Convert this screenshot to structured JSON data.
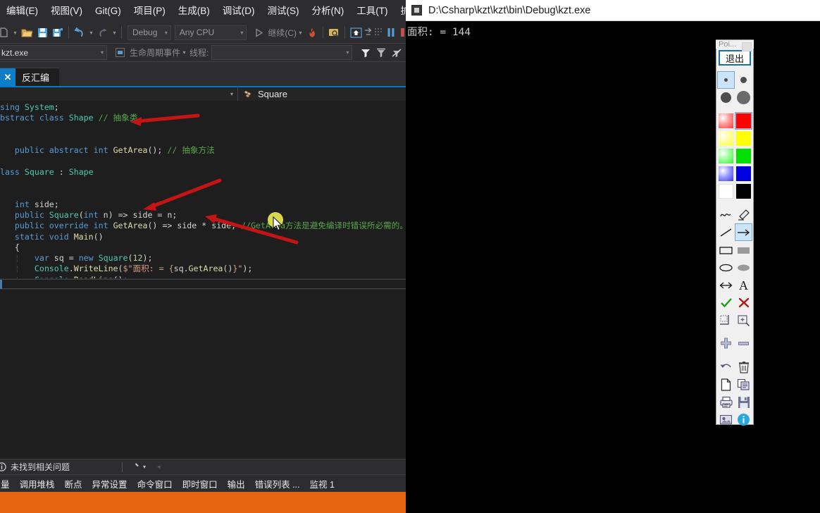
{
  "ide": {
    "menubar": [
      "编辑(E)",
      "视图(V)",
      "Git(G)",
      "项目(P)",
      "生成(B)",
      "调试(D)",
      "测试(S)",
      "分析(N)",
      "工具(T)",
      "扩展(X)"
    ],
    "toolbar": {
      "config_value": "Debug",
      "platform_value": "Any CPU",
      "continue_label": "继续(C)"
    },
    "debugbar": {
      "process_value": "kzt.exe",
      "lifecycle_label": "生命周期事件",
      "thread_label": "线程:",
      "thread_value": ""
    },
    "tab": {
      "close_glyph": "✕",
      "label": "反汇编"
    },
    "navbar": {
      "left_value": "",
      "right_label": "Square"
    },
    "code": {
      "lines": [
        "using System;",
        "abstract class Shape // 抽象类",
        "{",
        "    public abstract int GetArea(); // 抽象方法",
        "}",
        "class Square : Shape",
        "{",
        "    int side;",
        "    public Square(int n) => side = n;",
        "    public override int GetArea() => side * side; //GetArea方法是避免编译时错误所必需的。",
        "    static void Main()",
        "    {",
        "        var sq = new Square(12);",
        "        Console.WriteLine($\"面积: = {sq.GetArea()}\");",
        "        Console.ReadLine();",
        "    }",
        "}"
      ]
    },
    "statusbar": {
      "issues_text": "未找到相关问题"
    },
    "dock_tabs": [
      "量",
      "调用堆栈",
      "断点",
      "异常设置",
      "命令窗口",
      "即时窗口",
      "输出",
      "错误列表 ...",
      "监视 1"
    ]
  },
  "console": {
    "title": "D:\\Csharp\\kzt\\kzt\\bin\\Debug\\kzt.exe",
    "output": "面积: = 144"
  },
  "paint_toolbar": {
    "title": "Poi...",
    "exit_label": "退出",
    "pen_sizes": [
      "pen-size-1",
      "pen-size-2",
      "pen-size-3",
      "pen-size-4"
    ],
    "pen_size_selected": 0,
    "colors": [
      {
        "name": "color-red-light",
        "hex": "#ff6f6f"
      },
      {
        "name": "color-red",
        "hex": "#ff0000"
      },
      {
        "name": "color-yellow-light",
        "hex": "#ffff7f"
      },
      {
        "name": "color-yellow",
        "hex": "#ffff00"
      },
      {
        "name": "color-green-light",
        "hex": "#7fff7f"
      },
      {
        "name": "color-green",
        "hex": "#00e000"
      },
      {
        "name": "color-blue-light",
        "hex": "#7f7fff"
      },
      {
        "name": "color-blue",
        "hex": "#0000e0"
      },
      {
        "name": "color-white",
        "hex": "#ffffff"
      },
      {
        "name": "color-black",
        "hex": "#000000"
      }
    ],
    "color_selected": 1,
    "tools": [
      "freehand-tool",
      "eraser-tool",
      "line-tool",
      "arrow-tool",
      "rectangle-outline-tool",
      "rectangle-filled-tool",
      "ellipse-outline-tool",
      "ellipse-filled-tool",
      "double-arrow-tool",
      "text-tool",
      "checkmark-tool",
      "cross-tool",
      "crop-tool",
      "magnifier-tool"
    ],
    "tool_selected": 3,
    "zoom_tools": [
      "zoom-in-button",
      "zoom-out-button"
    ],
    "actions": [
      "undo-button",
      "delete-button",
      "new-page-button",
      "copy-button",
      "print-button",
      "save-button",
      "screenshot-button",
      "info-button"
    ]
  },
  "annotations": {
    "accent_red": "#c41414",
    "highlight_yellow": "#d8d84a"
  }
}
